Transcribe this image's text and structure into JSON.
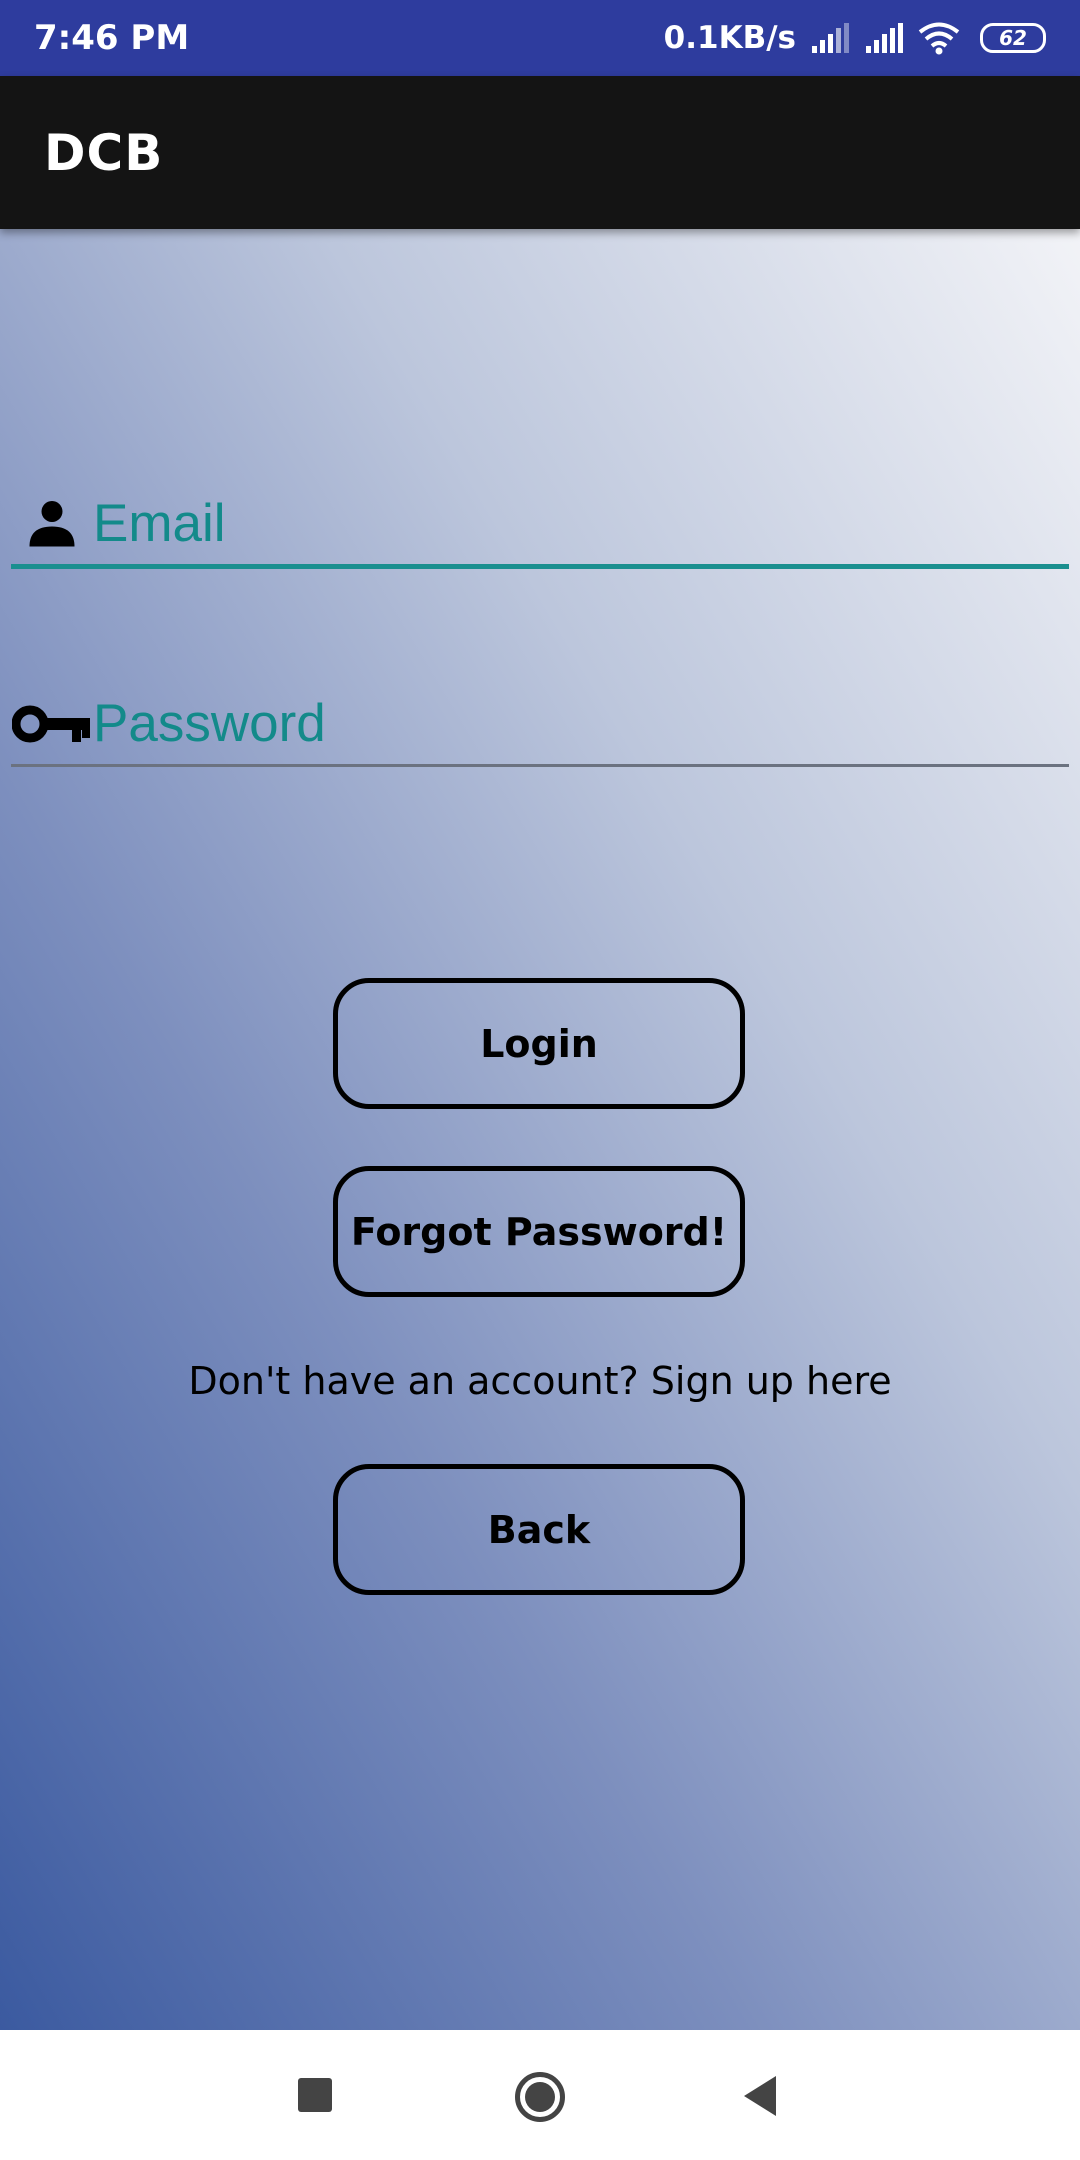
{
  "status_bar": {
    "time": "7:46 PM",
    "net_speed": "0.1KB/s",
    "battery": "62"
  },
  "app_bar": {
    "title": "DCB"
  },
  "login_form": {
    "email_placeholder": "Email",
    "password_placeholder": "Password",
    "login_label": "Login",
    "forgot_label": "Forgot Password!",
    "signup_text": "Don't have an account? Sign up here",
    "back_label": "Back"
  },
  "colors": {
    "status_bar": "#2e3c9e",
    "app_bar": "#141414",
    "accent_teal": "#138a8a"
  },
  "icons": {
    "email_field": "person-icon",
    "password_field": "key-icon",
    "nav": [
      "recent-apps-icon",
      "home-icon",
      "back-icon"
    ]
  }
}
